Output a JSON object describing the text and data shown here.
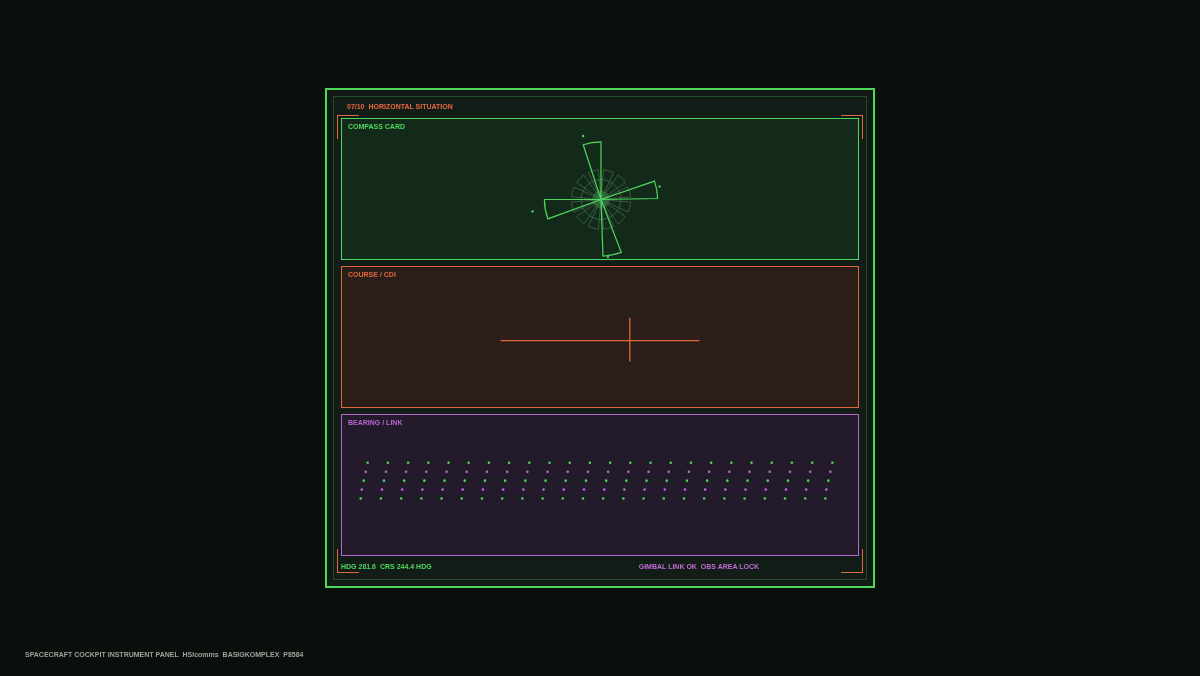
{
  "panel": {
    "title": "07/10  HORIZONTAL SITUATION"
  },
  "sections": [
    {
      "kind": "compass",
      "label": "COMPASS CARD"
    },
    {
      "kind": "cdi",
      "label": "COURSE / CDI"
    },
    {
      "kind": "bearing",
      "label": "BEARING / LINK"
    }
  ],
  "readouts": {
    "heading": "HDG 281.6  CRS 244.4 HDG",
    "link": "GIMBAL LINK OK  OBS AREA LOCK"
  },
  "caption": "SPACECRAFT COCKPIT INSTRUMENT PANEL  HSIcomms  BASIGKOMPLEX  P8584"
}
